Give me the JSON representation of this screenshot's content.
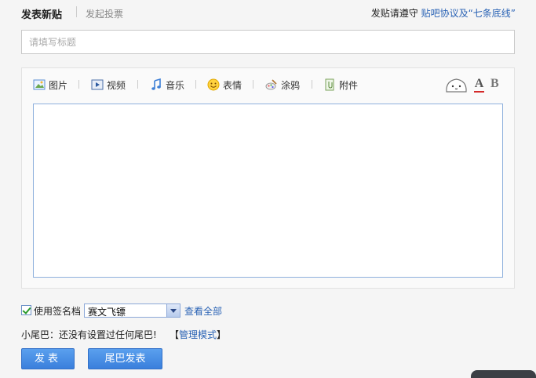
{
  "header": {
    "title": "发表新贴",
    "vote_link": "发起投票",
    "rules_prefix": "发贴请遵守",
    "rules_link": "贴吧协议及“七条底线”"
  },
  "title_field": {
    "placeholder": "请填写标题",
    "value": ""
  },
  "toolbar": {
    "items": [
      {
        "label": "图片",
        "icon": "image-icon"
      },
      {
        "label": "视频",
        "icon": "video-icon"
      },
      {
        "label": "音乐",
        "icon": "music-icon"
      },
      {
        "label": "表情",
        "icon": "emoji-icon"
      },
      {
        "label": "涂鸦",
        "icon": "doodle-icon"
      },
      {
        "label": "附件",
        "icon": "attachment-icon"
      }
    ],
    "right_icons": {
      "mascot": "mascot-icon",
      "font_color_glyph": "A",
      "font_color": "#d42a2a",
      "bold_glyph": "B"
    }
  },
  "signature": {
    "checked": true,
    "label": "使用签名档",
    "selected": "赛文飞镖",
    "view_all": "查看全部"
  },
  "tail": {
    "text": "小尾巴：还没有设置过任何尾巴!",
    "manage_open": "【",
    "manage_link": "管理模式",
    "manage_close": "】"
  },
  "buttons": {
    "publish": "发表",
    "tail_publish": "尾巴发表"
  },
  "colors": {
    "link": "#2a63b5",
    "button": "#3a7fdc",
    "editor_border": "#8eb0dd"
  }
}
